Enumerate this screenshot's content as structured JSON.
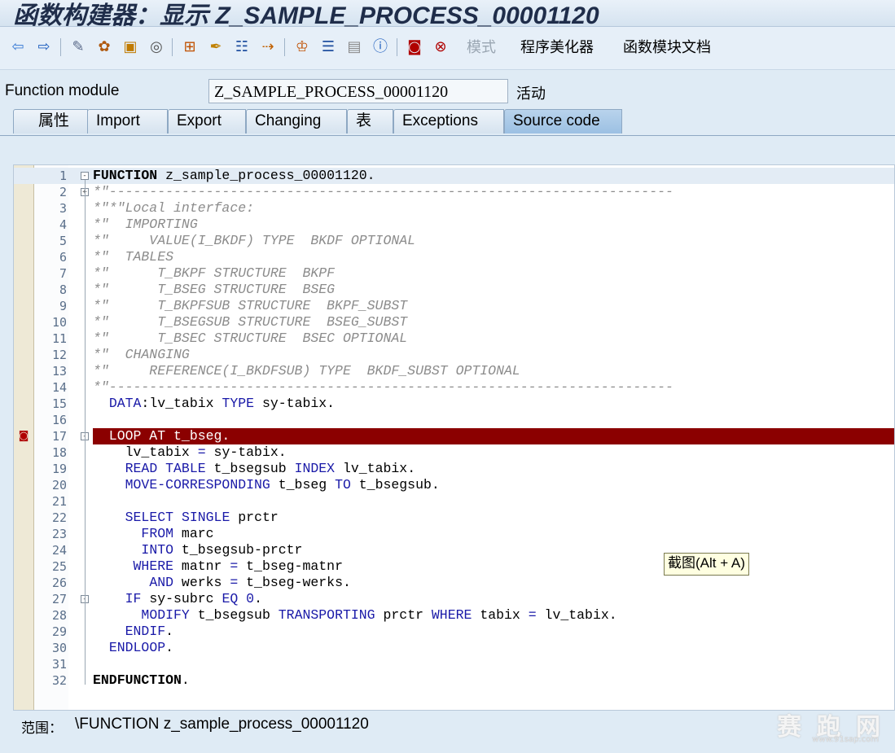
{
  "window": {
    "title": "函数构建器：显示 Z_SAMPLE_PROCESS_00001120"
  },
  "toolbar": {
    "icons": [
      "back-arrow-icon",
      "forward-arrow-icon",
      "other-object-icon",
      "display-change-icon",
      "activate-icon",
      "check-icon",
      "where-used-icon",
      "stack-icon",
      "test-icon",
      "navigate-icon",
      "display-object-list-icon",
      "hierarchy-icon",
      "enhance-icon",
      "notes-icon",
      "info-icon",
      "breakpoint-icon",
      "external-breakpoint-icon"
    ],
    "mode_label": "模式",
    "pretty_printer_label": "程序美化器",
    "documentation_label": "函数模块文档"
  },
  "function_module": {
    "label": "Function module",
    "value": "Z_SAMPLE_PROCESS_00001120",
    "status": "活动"
  },
  "tabs": [
    {
      "label": "属性"
    },
    {
      "label": "Import"
    },
    {
      "label": "Export"
    },
    {
      "label": "Changing"
    },
    {
      "label": "表"
    },
    {
      "label": "Exceptions"
    },
    {
      "label": "Source code",
      "active": true
    }
  ],
  "code_lines": [
    {
      "n": "1",
      "text": "FUNCTION z_sample_process_00001120."
    },
    {
      "n": "2",
      "text": "*\"----------------------------------------------------------------------"
    },
    {
      "n": "3",
      "text": "*\"*\"Local interface:"
    },
    {
      "n": "4",
      "text": "*\"  IMPORTING"
    },
    {
      "n": "5",
      "text": "*\"     VALUE(I_BKDF) TYPE  BKDF OPTIONAL"
    },
    {
      "n": "6",
      "text": "*\"  TABLES"
    },
    {
      "n": "7",
      "text": "*\"      T_BKPF STRUCTURE  BKPF"
    },
    {
      "n": "8",
      "text": "*\"      T_BSEG STRUCTURE  BSEG"
    },
    {
      "n": "9",
      "text": "*\"      T_BKPFSUB STRUCTURE  BKPF_SUBST"
    },
    {
      "n": "10",
      "text": "*\"      T_BSEGSUB STRUCTURE  BSEG_SUBST"
    },
    {
      "n": "11",
      "text": "*\"      T_BSEC STRUCTURE  BSEC OPTIONAL"
    },
    {
      "n": "12",
      "text": "*\"  CHANGING"
    },
    {
      "n": "13",
      "text": "*\"     REFERENCE(I_BKDFSUB) TYPE  BKDF_SUBST OPTIONAL"
    },
    {
      "n": "14",
      "text": "*\"----------------------------------------------------------------------"
    },
    {
      "n": "15",
      "text": "  DATA:lv_tabix TYPE sy-tabix."
    },
    {
      "n": "16",
      "text": ""
    },
    {
      "n": "17",
      "text": "  LOOP AT t_bseg."
    },
    {
      "n": "18",
      "text": "    lv_tabix = sy-tabix."
    },
    {
      "n": "19",
      "text": "    READ TABLE t_bsegsub INDEX lv_tabix."
    },
    {
      "n": "20",
      "text": "    MOVE-CORRESPONDING t_bseg TO t_bsegsub."
    },
    {
      "n": "21",
      "text": ""
    },
    {
      "n": "22",
      "text": "    SELECT SINGLE prctr"
    },
    {
      "n": "23",
      "text": "      FROM marc"
    },
    {
      "n": "24",
      "text": "      INTO t_bsegsub-prctr"
    },
    {
      "n": "25",
      "text": "     WHERE matnr = t_bseg-matnr"
    },
    {
      "n": "26",
      "text": "       AND werks = t_bseg-werks."
    },
    {
      "n": "27",
      "text": "    IF sy-subrc EQ 0."
    },
    {
      "n": "28",
      "text": "      MODIFY t_bsegsub TRANSPORTING prctr WHERE tabix = lv_tabix."
    },
    {
      "n": "29",
      "text": "    ENDIF."
    },
    {
      "n": "30",
      "text": "  ENDLOOP."
    },
    {
      "n": "31",
      "text": ""
    },
    {
      "n": "32",
      "text": "ENDFUNCTION."
    }
  ],
  "breakpoint_line": "17",
  "tooltip": {
    "text": "截图(Alt + A)"
  },
  "status": {
    "label": "范围：",
    "value": "\\FUNCTION z_sample_process_00001120"
  },
  "watermark": {
    "text": "赛 跑 网",
    "sub": "www.91sap.com"
  },
  "colors": {
    "breakpoint_bg": "#8b0000",
    "keyword": "#1a1aa8",
    "comment": "#8c8c8c",
    "background": "#dfebf5"
  }
}
